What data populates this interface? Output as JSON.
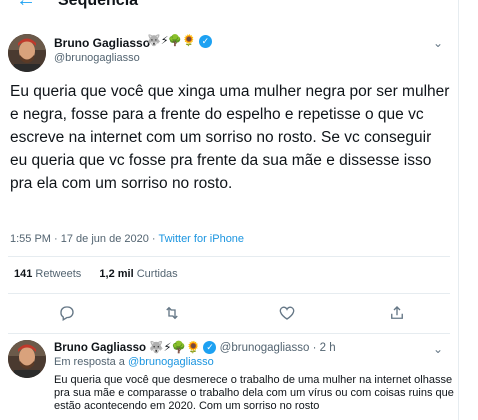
{
  "header": {
    "title": "Sequência",
    "back_icon": "arrow-left-icon"
  },
  "tweet": {
    "author_name": "Bruno Gagliasso",
    "badges": "🐺⚡🌳🌻",
    "handle": "@brunogagliasso",
    "text": "Eu queria que você que xinga uma mulher negra por ser mulher e negra, fosse para a frente do espelho e repetisse o que vc escreve na internet com um sorriso no rosto. Se vc conseguir eu queria que vc fosse pra frente da sua mãe e dissesse isso pra ela com um sorriso no rosto.",
    "time": "1:55 PM",
    "date": "17 de jun de 2020",
    "client": "Twitter for iPhone",
    "retweets_count": "141",
    "retweets_label": "Retweets",
    "likes_count": "1,2 mil",
    "likes_label": "Curtidas"
  },
  "reply": {
    "author_name": "Bruno Gagliasso",
    "badges": "🐺⚡🌳🌻",
    "handle": "@brunogagliasso",
    "age": "2 h",
    "reply_to_prefix": "Em resposta a",
    "reply_to_handle": "@brunogagliasso",
    "text": "Eu queria que você que desmerece o trabalho de uma mulher na internet olhasse pra sua mãe e comparasse o trabalho dela com um vírus ou com coisas ruins que estão acontecendo em 2020. Com um sorriso no rosto"
  },
  "colors": {
    "accent": "#1da1f2",
    "link": "#1b95e0",
    "muted": "#536471",
    "divider": "#e6ecf0"
  }
}
